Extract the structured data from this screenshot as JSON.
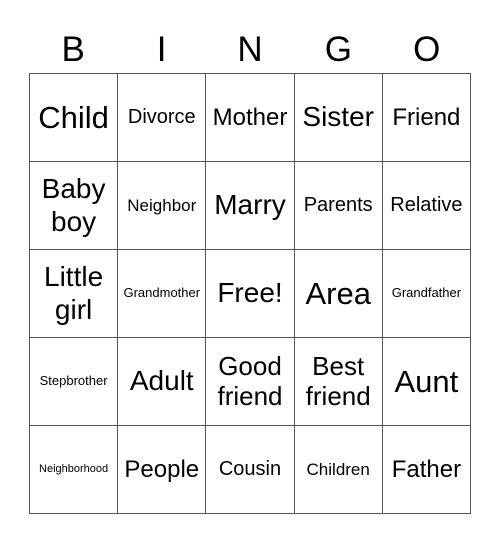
{
  "title_letters": [
    "B",
    "I",
    "N",
    "G",
    "O"
  ],
  "cells": [
    [
      "Child",
      "Divorce",
      "Mother",
      "Sister",
      "Friend"
    ],
    [
      "Baby boy",
      "Neighbor",
      "Marry",
      "Parents",
      "Relative"
    ],
    [
      "Little girl",
      "Grandmother",
      "Free!",
      "Area",
      "Grandfather"
    ],
    [
      "Stepbrother",
      "Adult",
      "Good friend",
      "Best friend",
      "Aunt"
    ],
    [
      "Neighborhood",
      "People",
      "Cousin",
      "Children",
      "Father"
    ]
  ]
}
